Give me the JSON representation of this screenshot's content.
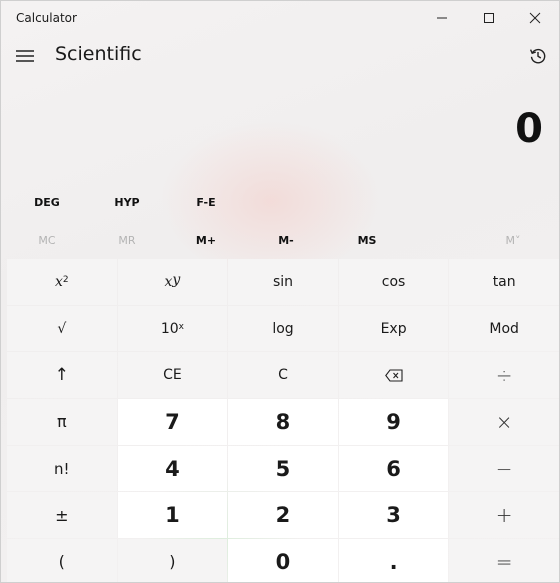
{
  "window": {
    "title": "Calculator"
  },
  "header": {
    "mode": "Scientific"
  },
  "display": {
    "value": "0"
  },
  "angle_row": [
    {
      "label": "DEG"
    },
    {
      "label": "HYP"
    },
    {
      "label": "F-E"
    }
  ],
  "memory_row": [
    {
      "label": "MC",
      "enabled": false
    },
    {
      "label": "MR",
      "enabled": false
    },
    {
      "label": "M+",
      "enabled": true
    },
    {
      "label": "M-",
      "enabled": true
    },
    {
      "label": "MS",
      "enabled": true
    },
    {
      "label": "M˅",
      "enabled": false
    }
  ],
  "keys": {
    "x2": {
      "base": "x",
      "sup": "2"
    },
    "xy": {
      "base": "x",
      "sup": "y"
    },
    "sin": "sin",
    "cos": "cos",
    "tan": "tan",
    "sqrt": "√",
    "tenx": {
      "base": "10",
      "sup": "x"
    },
    "log": "log",
    "exp": "Exp",
    "mod": "Mod",
    "up": "↑",
    "ce": "CE",
    "c": "C",
    "backspace": "⌫",
    "divide": "÷",
    "pi": "π",
    "seven": "7",
    "eight": "8",
    "nine": "9",
    "multiply": "×",
    "factorial": "n!",
    "four": "4",
    "five": "5",
    "six": "6",
    "minus": "−",
    "plusminus": "±",
    "one": "1",
    "two": "2",
    "three": "3",
    "plus": "+",
    "lparen": "(",
    "rparen": ")",
    "zero": "0",
    "decimal": ".",
    "equals": "="
  }
}
